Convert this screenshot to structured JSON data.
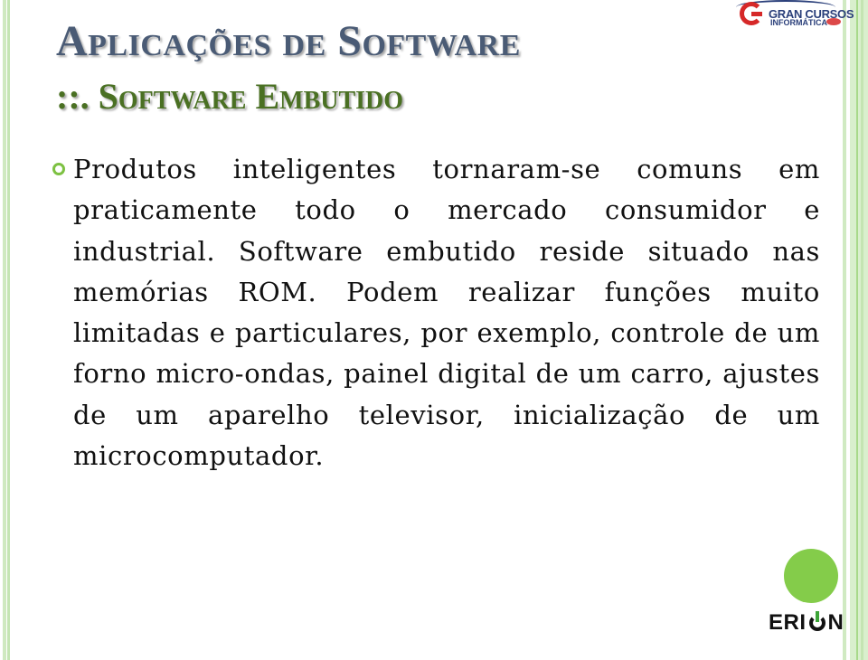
{
  "header": {
    "title": "Aplicações de Software",
    "subtitle": "::. Software Embutido"
  },
  "logos": {
    "top_right": {
      "line1": "GRAN CURSOS",
      "line2": "INFORMÁTICA",
      "icon": "gran-cursos-logo-icon"
    },
    "bottom_right": {
      "text_before": "ERI",
      "text_after": "N",
      "icon": "power-icon"
    }
  },
  "content": {
    "bullets": [
      {
        "icon": "ring-bullet-icon",
        "text": "Produtos inteligentes tornaram-se comuns em praticamente todo o mercado consumidor e industrial. Software embutido reside situado nas memórias ROM. Podem realizar funções muito limitadas e particulares, por exemplo, controle de um forno micro-ondas, painel digital de um carro, ajustes de um aparelho televisor, inicialização de um microcomputador."
      }
    ]
  },
  "colors": {
    "title": "#4a5b75",
    "subtitle": "#4a7023",
    "bullet": "#7dc142",
    "accent_green": "#84cc4a",
    "logo_red": "#d62828",
    "logo_blue": "#2a3f7a"
  }
}
